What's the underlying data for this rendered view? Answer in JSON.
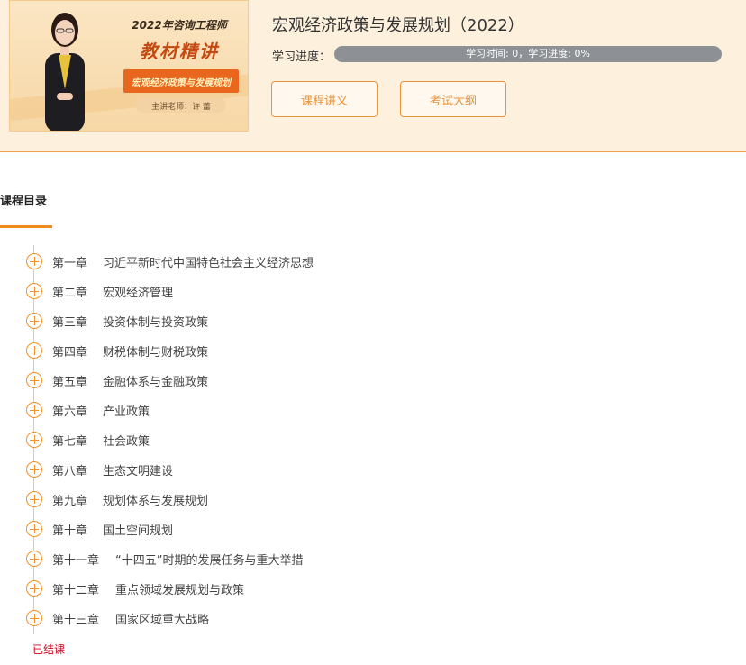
{
  "course": {
    "title": "宏观经济政策与发展规划（2022）",
    "progress_label": "学习进度：",
    "progress_text": "学习时间: 0，学习进度: 0%",
    "progress_fraction": 0,
    "buttons": {
      "notes": "课程讲义",
      "syllabus": "考试大纲"
    }
  },
  "thumbnail": {
    "top_line": "2022年咨询工程师",
    "big_title": "教材精讲",
    "banner": "宏观经济政策与发展规划",
    "teacher": "主讲老师：许 蕾"
  },
  "catalog": {
    "title": "课程目录",
    "chapters": [
      {
        "num": "第一章",
        "name": "习近平新时代中国特色社会主义经济思想"
      },
      {
        "num": "第二章",
        "name": "宏观经济管理"
      },
      {
        "num": "第三章",
        "name": "投资体制与投资政策"
      },
      {
        "num": "第四章",
        "name": "财税体制与财税政策"
      },
      {
        "num": "第五章",
        "name": "金融体系与金融政策"
      },
      {
        "num": "第六章",
        "name": "产业政策"
      },
      {
        "num": "第七章",
        "name": "社会政策"
      },
      {
        "num": "第八章",
        "name": "生态文明建设"
      },
      {
        "num": "第九章",
        "name": "规划体系与发展规划"
      },
      {
        "num": "第十章",
        "name": "国土空间规划"
      },
      {
        "num": "第十一章",
        "name": "“十四五”时期的发展任务与重大举措"
      },
      {
        "num": "第十二章",
        "name": "重点领域发展规划与政策"
      },
      {
        "num": "第十三章",
        "name": "国家区域重大战略"
      }
    ],
    "status": "已结课"
  },
  "colors": {
    "accent": "#f08c1e",
    "header_bg": "#fdf1dd",
    "status_red": "#d0021b"
  }
}
